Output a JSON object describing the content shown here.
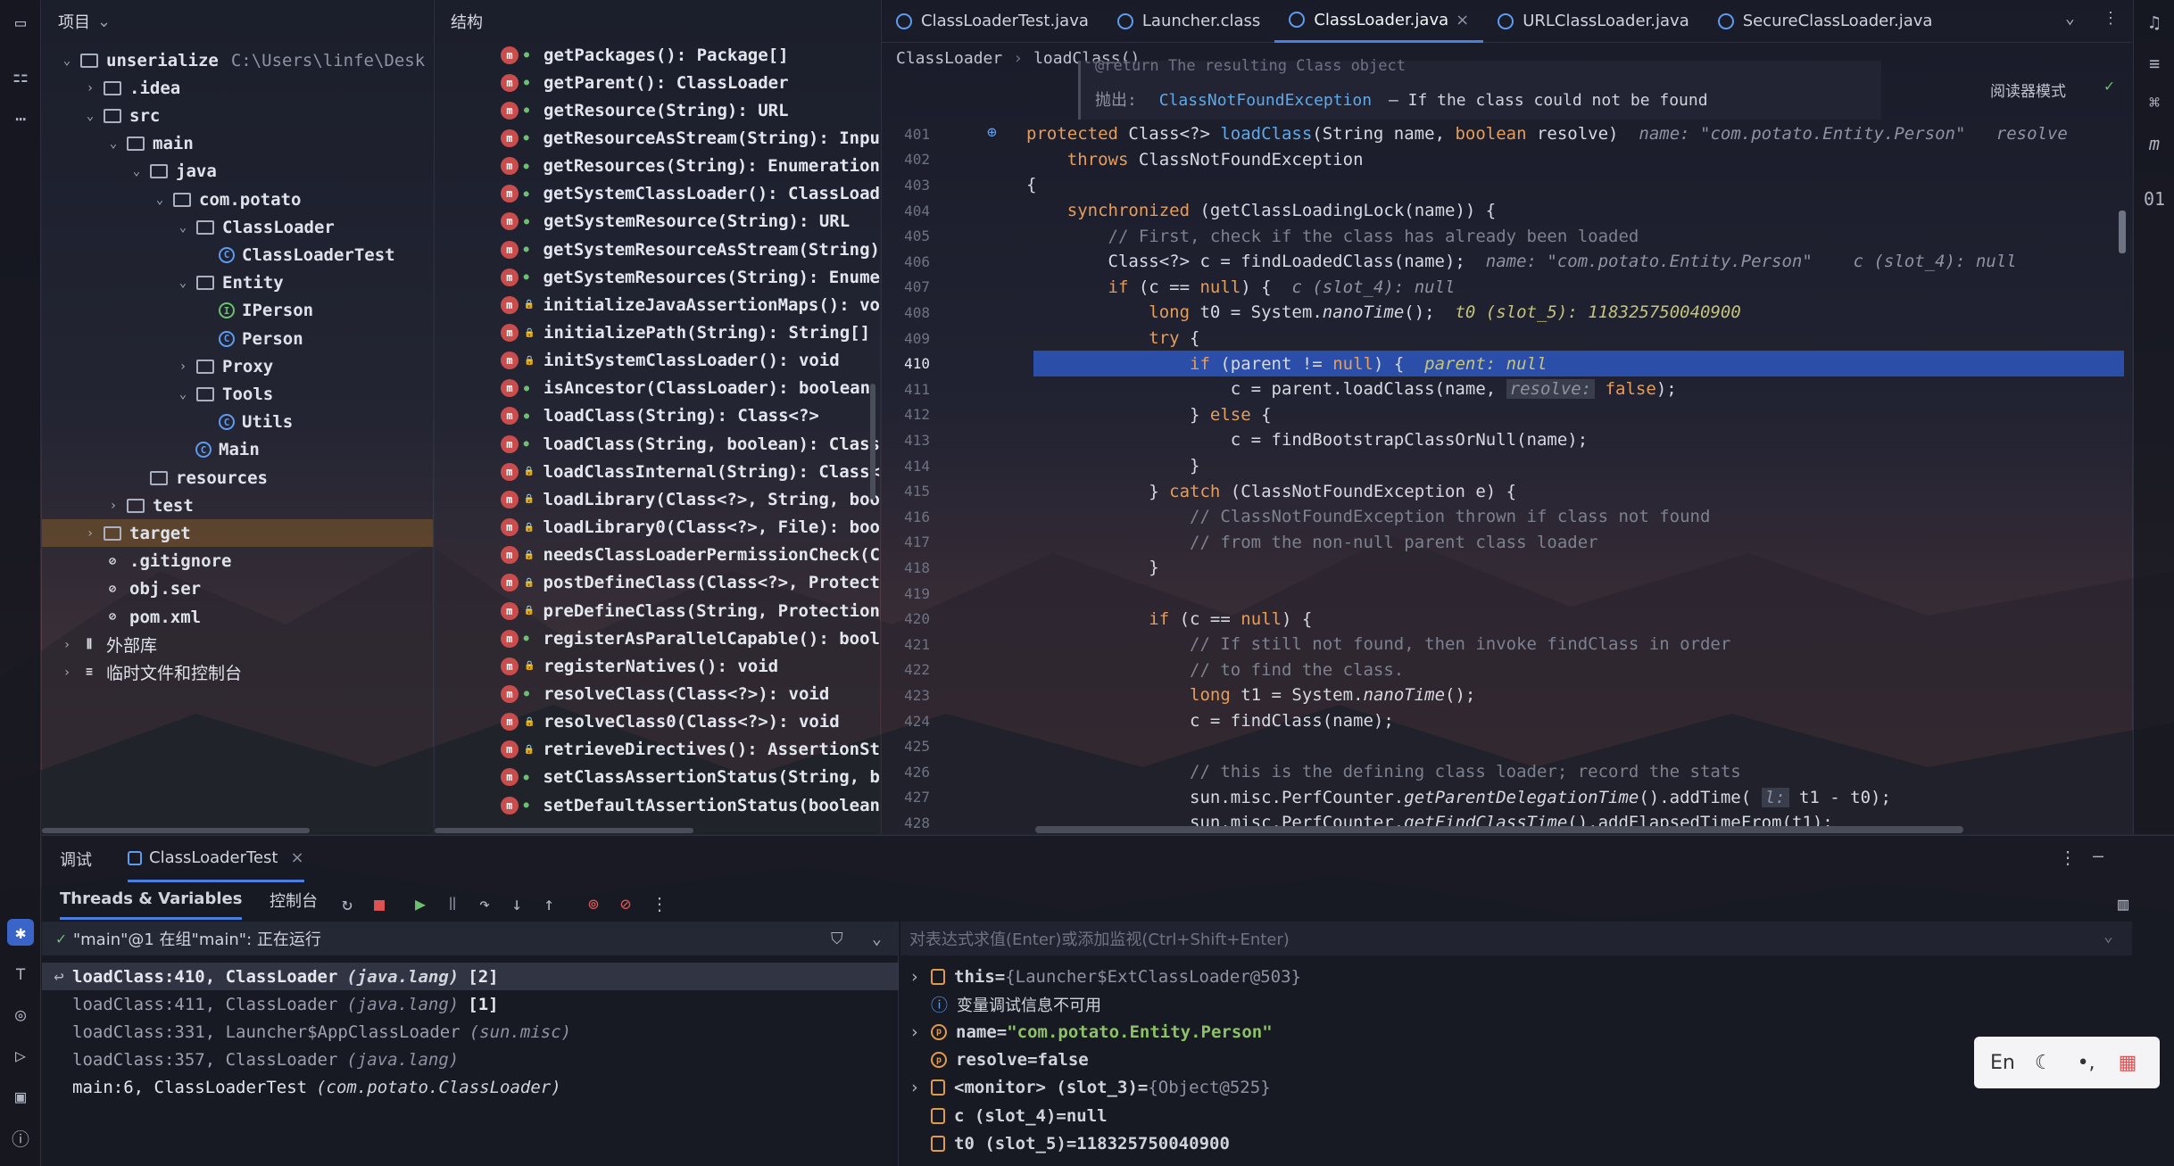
{
  "project": {
    "header": "项目",
    "items": [
      {
        "label": "unserialize",
        "path": "C:\\Users\\linfe\\Desk",
        "type": "module",
        "arrow": "v"
      },
      {
        "label": ".idea",
        "type": "folder",
        "arrow": ">"
      },
      {
        "label": "src",
        "type": "folder",
        "arrow": "v"
      },
      {
        "label": "main",
        "type": "folder",
        "arrow": "v"
      },
      {
        "label": "java",
        "type": "folder",
        "arrow": "v"
      },
      {
        "label": "com.potato",
        "type": "package",
        "arrow": "v"
      },
      {
        "label": "ClassLoader",
        "type": "package",
        "arrow": "v"
      },
      {
        "label": "ClassLoaderTest",
        "type": "class",
        "arrow": ""
      },
      {
        "label": "Entity",
        "type": "package",
        "arrow": "v"
      },
      {
        "label": "IPerson",
        "type": "interface",
        "arrow": ""
      },
      {
        "label": "Person",
        "type": "class",
        "arrow": ""
      },
      {
        "label": "Proxy",
        "type": "package",
        "arrow": ">"
      },
      {
        "label": "Tools",
        "type": "package",
        "arrow": "v"
      },
      {
        "label": "Utils",
        "type": "class",
        "arrow": ""
      },
      {
        "label": "Main",
        "type": "class",
        "arrow": ""
      },
      {
        "label": "resources",
        "type": "folder",
        "arrow": ""
      },
      {
        "label": "test",
        "type": "folder",
        "arrow": ">"
      },
      {
        "label": "target",
        "type": "folder",
        "arrow": ">"
      },
      {
        "label": ".gitignore",
        "type": "file",
        "arrow": ""
      },
      {
        "label": "obj.ser",
        "type": "file",
        "arrow": ""
      },
      {
        "label": "pom.xml",
        "type": "file",
        "arrow": ""
      },
      {
        "label": "外部库",
        "type": "lib",
        "arrow": ">"
      },
      {
        "label": "临时文件和控制台",
        "type": "scratch",
        "arrow": ">"
      }
    ]
  },
  "structure": {
    "header": "结构",
    "items": [
      "getPackages(): Package[]",
      "getParent(): ClassLoader",
      "getResource(String): URL",
      "getResourceAsStream(String): Inpu",
      "getResources(String): Enumeration",
      "getSystemClassLoader(): ClassLoad",
      "getSystemResource(String): URL",
      "getSystemResourceAsStream(String)",
      "getSystemResources(String): Enume",
      "initializeJavaAssertionMaps(): vo",
      "initializePath(String): String[]",
      "initSystemClassLoader(): void",
      "isAncestor(ClassLoader): boolean",
      "loadClass(String): Class<?>",
      "loadClass(String, boolean): Class",
      "loadClassInternal(String): Class<",
      "loadLibrary(Class<?>, String, boo",
      "loadLibrary0(Class<?>, File): boo",
      "needsClassLoaderPermissionCheck(C",
      "postDefineClass(Class<?>, Protect",
      "preDefineClass(String, Protection",
      "registerAsParallelCapable(): bool",
      "registerNatives(): void",
      "resolveClass(Class<?>): void",
      "resolveClass0(Class<?>): void",
      "retrieveDirectives(): AssertionSt",
      "setClassAssertionStatus(String, b",
      "setDefaultAssertionStatus(boolean"
    ]
  },
  "editor": {
    "tabs": [
      "ClassLoaderTest.java",
      "Launcher.class",
      "ClassLoader.java",
      "URLClassLoader.java",
      "SecureClassLoader.java"
    ],
    "active_tab": 2,
    "breadcrumb": [
      "ClassLoader",
      "loadClass()"
    ],
    "reader_mode": "阅读器模式",
    "doc_throws_label": "抛出:",
    "doc_throws_type": "ClassNotFoundException",
    "doc_throws_text": "– If the class could not be found",
    "doc_partial": "@return The resulting Class object",
    "line_numbers": [
      "401",
      "402",
      "403",
      "404",
      "405",
      "406",
      "407",
      "408",
      "409",
      "410",
      "411",
      "412",
      "413",
      "414",
      "415",
      "416",
      "417",
      "418",
      "419",
      "420",
      "421",
      "422",
      "423",
      "424",
      "425",
      "426",
      "427",
      "428"
    ],
    "current_line": "410",
    "hints": {
      "l401": "name: \"com.potato.Entity.Person\"",
      "l401b": "resolve",
      "l406a": "name: \"com.potato.Entity.Person\"",
      "l406b": "c (slot_4): null",
      "l407": "c (slot_4): null",
      "l408": "t0 (slot_5): 118325750040900",
      "l410": "parent: null",
      "l411": "resolve:",
      "l427": "l:"
    }
  },
  "debug": {
    "tab_debug": "调试",
    "tab_session": "ClassLoaderTest",
    "subtab_threads": "Threads & Variables",
    "subtab_console": "控制台",
    "thread_label": "\"main\"@1 在组\"main\": 正在运行",
    "eval_placeholder": "对表达式求值(Enter)或添加监视(Ctrl+Shift+Enter)",
    "frames": [
      {
        "method": "loadClass:410, ClassLoader",
        "pkg": "(java.lang)",
        "count": "[2]"
      },
      {
        "method": "loadClass:411, ClassLoader",
        "pkg": "(java.lang)",
        "count": "[1]"
      },
      {
        "method": "loadClass:331, Launcher$AppClassLoader",
        "pkg": "(sun.misc)",
        "count": ""
      },
      {
        "method": "loadClass:357, ClassLoader",
        "pkg": "(java.lang)",
        "count": ""
      },
      {
        "method": "main:6, ClassLoaderTest",
        "pkg": "(com.potato.ClassLoader)",
        "count": ""
      }
    ],
    "variables": [
      {
        "name": "this",
        "value": "{Launcher$ExtClassLoader@503}",
        "expand": ">"
      },
      {
        "name": "变量调试信息不可用",
        "value": "",
        "expand": ""
      },
      {
        "name": "name",
        "value": "\"com.potato.Entity.Person\"",
        "expand": ">"
      },
      {
        "name": "resolve",
        "value": "false",
        "expand": ""
      },
      {
        "name": "<monitor> (slot_3)",
        "value": "{Object@525}",
        "expand": ">"
      },
      {
        "name": "c (slot_4)",
        "value": "null",
        "expand": ""
      },
      {
        "name": "t0 (slot_5)",
        "value": "118325750040900",
        "expand": ""
      }
    ]
  },
  "ime": {
    "lang": "En"
  },
  "colors": {
    "accent": "#4a7fe0",
    "highlight": "#2b4fa8",
    "method_icon": "#c94d4d"
  }
}
